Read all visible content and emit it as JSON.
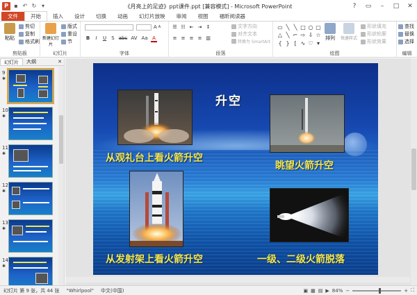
{
  "window": {
    "title": "《月亮上的足迹》ppt课件.ppt [兼容模式] - Microsoft PowerPoint",
    "logo_letter": "P"
  },
  "quick_access": [
    "save-icon",
    "undo-icon",
    "redo-icon",
    "customize-icon"
  ],
  "tabs": [
    {
      "label": "文件"
    },
    {
      "label": "开始"
    },
    {
      "label": "插入"
    },
    {
      "label": "设计"
    },
    {
      "label": "切换"
    },
    {
      "label": "动画"
    },
    {
      "label": "幻灯片放映"
    },
    {
      "label": "审阅"
    },
    {
      "label": "视图"
    },
    {
      "label": "福昕阅读器"
    }
  ],
  "ribbon": {
    "clipboard": {
      "paste": "粘贴",
      "cut": "剪切",
      "copy": "复制",
      "format_painter": "格式刷",
      "label": "剪贴板"
    },
    "slides": {
      "new_slide": "新建幻灯片",
      "layout": "版式",
      "reset": "重设",
      "section": "节",
      "label": "幻灯片"
    },
    "font": {
      "label": "字体",
      "bold": "B",
      "italic": "I",
      "underline": "U",
      "shadow": "S",
      "strike": "abc",
      "spacing": "AV",
      "case": "Aa",
      "color": "A"
    },
    "paragraph": {
      "label": "段落",
      "text_direction": "文字方向",
      "align_text": "对齐文本",
      "smartart": "转换为 SmartArt"
    },
    "drawing": {
      "label": "绘图",
      "arrange": "排列",
      "quick_styles": "快速样式",
      "shape_fill": "形状填充",
      "shape_outline": "形状轮廓",
      "shape_effects": "形状效果"
    },
    "editing": {
      "label": "编辑",
      "find": "查找",
      "replace": "替换",
      "select": "选择"
    }
  },
  "left_pane": {
    "tab_slides": "幻灯片",
    "tab_outline": "大纲",
    "thumbnails": [
      {
        "num": "9",
        "selected": true
      },
      {
        "num": "10",
        "selected": false
      },
      {
        "num": "11",
        "selected": false
      },
      {
        "num": "12",
        "selected": false
      },
      {
        "num": "13",
        "selected": false
      },
      {
        "num": "14",
        "selected": false
      }
    ]
  },
  "slide": {
    "title": "升空",
    "captions": {
      "top_left": "从观礼台上看火箭升空",
      "top_right": "眺望火箭升空",
      "bottom_left": "从发射架上看火箭升空",
      "bottom_right": "一级、二级火箭脱落"
    }
  },
  "status": {
    "slide_info": "幻灯片 第 9 张，共 44 张",
    "theme": "\"Whirlpool\"",
    "language": "中文(中国)",
    "zoom": "84%"
  },
  "colors": {
    "accent": "#d24726",
    "caption_yellow": "#f5e64a"
  }
}
